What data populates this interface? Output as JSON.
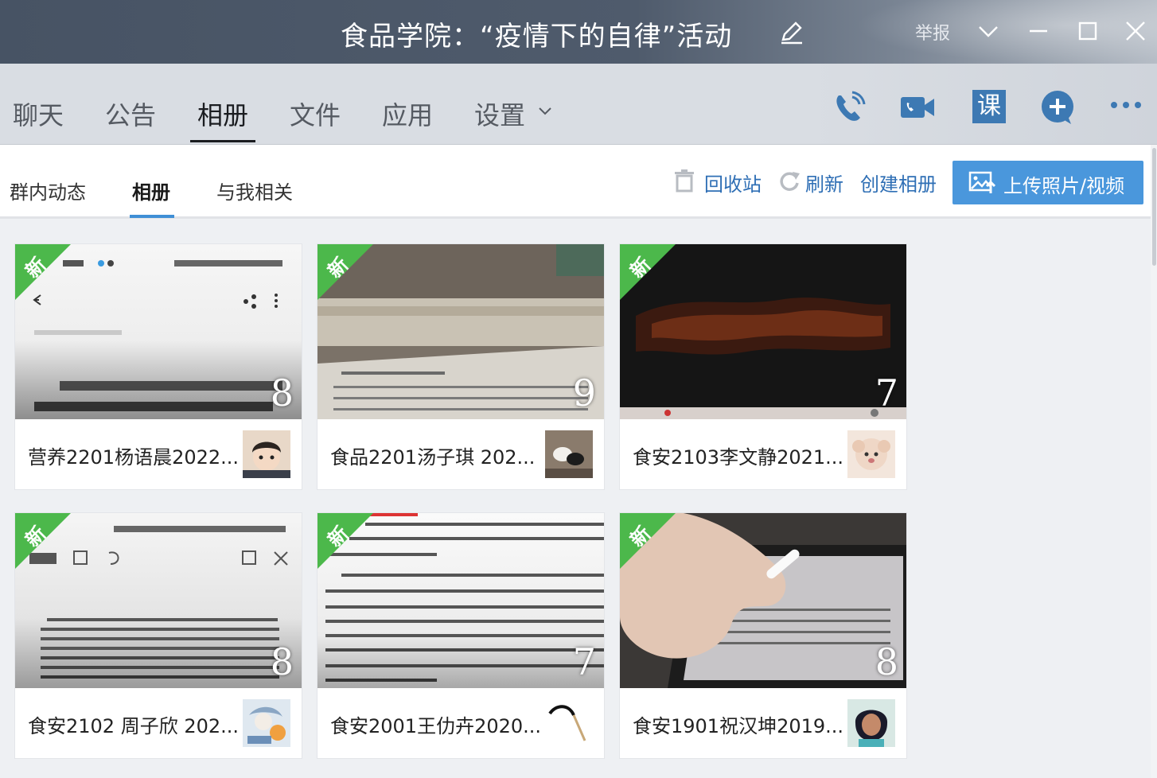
{
  "window": {
    "title": "食品学院：“疫情下的自律”活动",
    "report_label": "举报"
  },
  "nav": {
    "tabs": [
      "聊天",
      "公告",
      "相册",
      "文件",
      "应用",
      "设置"
    ],
    "active_tab": "相册"
  },
  "toolbar_icons": [
    "phone-icon",
    "video-call-icon",
    "class-icon",
    "add-icon",
    "more-icon"
  ],
  "class_icon_label": "课",
  "subnav": {
    "tabs": [
      "群内动态",
      "相册",
      "与我相关"
    ],
    "active_tab": "相册",
    "recycle_label": "回收站",
    "refresh_label": "刷新",
    "create_label": "创建相册",
    "upload_label": "上传照片/视频"
  },
  "albums": [
    {
      "name": "营养2201杨语晨2022...",
      "count": "8",
      "badge": "新"
    },
    {
      "name": "食品2201汤子琪 202...",
      "count": "9",
      "badge": "新"
    },
    {
      "name": "食安2103李文静2021...",
      "count": "7",
      "badge": "新"
    },
    {
      "name": "食安2102 周子欣 202...",
      "count": "8",
      "badge": "新"
    },
    {
      "name": "食安2001王仂卉2020...",
      "count": "7",
      "badge": "新"
    },
    {
      "name": "食安1901祝汉坤2019...",
      "count": "8",
      "badge": "新"
    }
  ],
  "colors": {
    "accent": "#4a97dc",
    "link": "#2f6fb5",
    "badge_green": "#4cb84b",
    "titlebar": "#475364"
  }
}
